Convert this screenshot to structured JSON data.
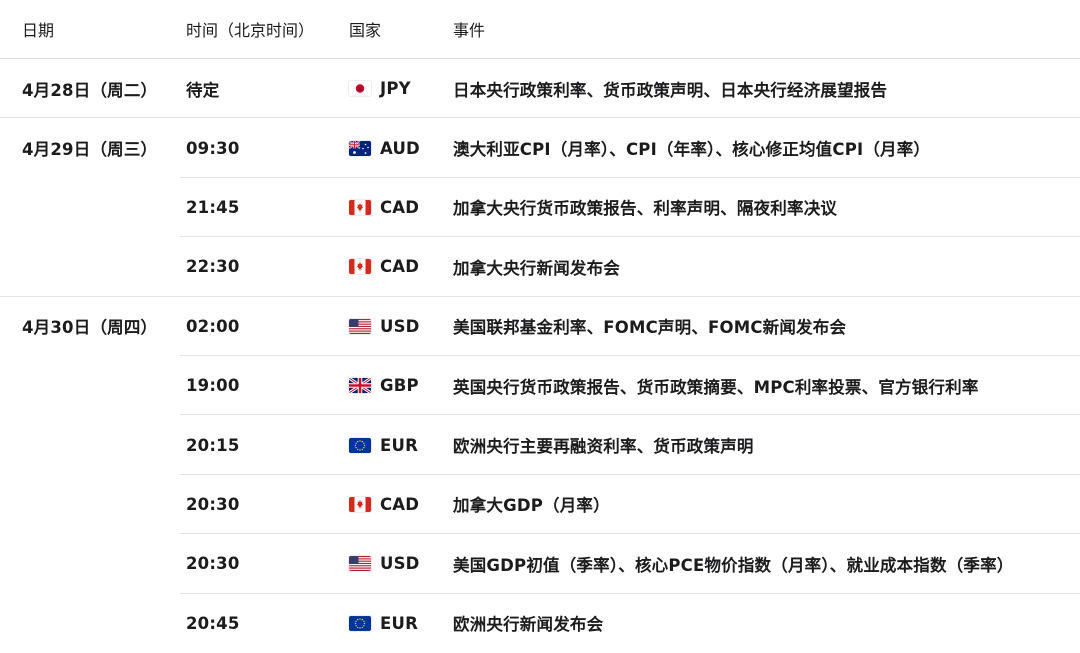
{
  "header": {
    "date": "日期",
    "time": "时间（北京时间）",
    "country": "国家",
    "event": "事件"
  },
  "rows": [
    {
      "date": "4月28日（周二）",
      "time": "待定",
      "flag": "jp-flag-icon",
      "ccy": "JPY",
      "event": "日本央行政策利率、货币政策声明、日本央行经济展望报告"
    },
    {
      "date": "4月29日（周三）",
      "time": "09:30",
      "flag": "au-flag-icon",
      "ccy": "AUD",
      "event": "澳大利亚CPI（月率）、CPI（年率）、核心修正均值CPI（月率）"
    },
    {
      "date": "",
      "time": "21:45",
      "flag": "ca-flag-icon",
      "ccy": "CAD",
      "event": "加拿大央行货币政策报告、利率声明、隔夜利率决议"
    },
    {
      "date": "",
      "time": "22:30",
      "flag": "ca-flag-icon",
      "ccy": "CAD",
      "event": "加拿大央行新闻发布会"
    },
    {
      "date": "4月30日（周四）",
      "time": "02:00",
      "flag": "us-flag-icon",
      "ccy": "USD",
      "event": "美国联邦基金利率、FOMC声明、FOMC新闻发布会"
    },
    {
      "date": "",
      "time": "19:00",
      "flag": "gb-flag-icon",
      "ccy": "GBP",
      "event": "英国央行货币政策报告、货币政策摘要、MPC利率投票、官方银行利率"
    },
    {
      "date": "",
      "time": "20:15",
      "flag": "eu-flag-icon",
      "ccy": "EUR",
      "event": "欧洲央行主要再融资利率、货币政策声明"
    },
    {
      "date": "",
      "time": "20:30",
      "flag": "ca-flag-icon",
      "ccy": "CAD",
      "event": "加拿大GDP（月率）"
    },
    {
      "date": "",
      "time": "20:30",
      "flag": "us-flag-icon",
      "ccy": "USD",
      "event": "美国GDP初值（季率）、核心PCE物价指数（月率）、就业成本指数（季率）"
    },
    {
      "date": "",
      "time": "20:45",
      "flag": "eu-flag-icon",
      "ccy": "EUR",
      "event": "欧洲央行新闻发布会"
    }
  ]
}
